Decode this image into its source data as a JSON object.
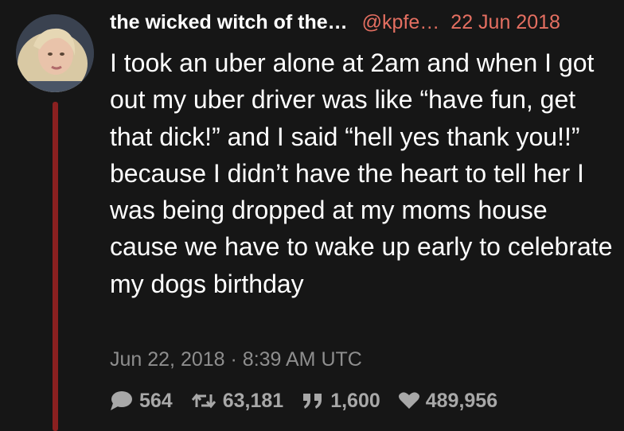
{
  "tweet": {
    "author": {
      "fullname": "the wicked witch of the…",
      "username": "@kpfe…",
      "date": "22 Jun 2018"
    },
    "text": "I took an uber alone at 2am and when I got out my uber driver was like “have fun, get that dick!” and I said “hell yes thank you!!” because I didn’t have the heart to tell her I was being dropped at my moms house cause we have to wake up early to celebrate my dogs birthday",
    "timestamp": "Jun 22, 2018 · 8:39 AM UTC",
    "stats": {
      "replies": "564",
      "retweets": "63,181",
      "quotes": "1,600",
      "likes": "489,956"
    }
  },
  "colors": {
    "background": "#161616",
    "accent": "#e46f61",
    "thread_line": "#8a2020",
    "muted_text": "#8e8e8e",
    "stat_text": "#a8a8a8"
  },
  "icons": {
    "replies": "comment-icon",
    "retweets": "retweet-icon",
    "quotes": "quote-icon",
    "likes": "heart-icon"
  }
}
